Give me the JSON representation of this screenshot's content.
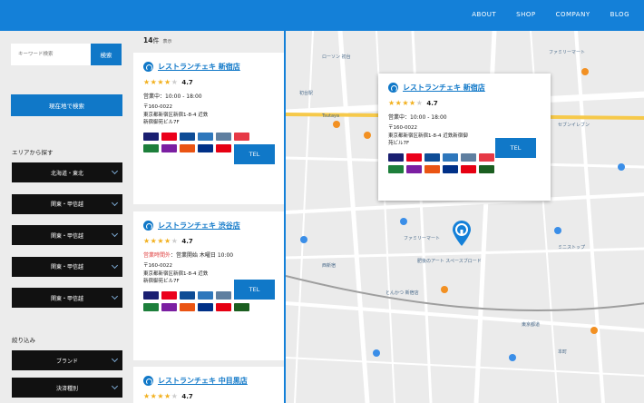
{
  "header": {
    "nav": [
      "ABOUT",
      "SHOP",
      "COMPANY",
      "BLOG"
    ],
    "brand_color": "#1480d8"
  },
  "sidebar": {
    "search_placeholder": "キーワード検索",
    "search_button": "検索",
    "locate_button": "現在地で検索",
    "area_heading": "エリアから探す",
    "areas": [
      "北海道・東北",
      "関東・甲信越",
      "関東・甲信越",
      "関東・甲信越",
      "関東・甲信越"
    ],
    "filter_heading": "絞り込み",
    "filters": [
      "ブランド",
      "決済種別"
    ]
  },
  "results": {
    "count": "14",
    "count_unit": "件",
    "count_suffix": "表示",
    "tel_label": "TEL",
    "cards": [
      {
        "name": "レストランチェキ 新宿店",
        "rating": "4.7",
        "rating_value": 4.7,
        "status": "営業中",
        "hours": "：10:00 - 18:00",
        "zip": "〒160-0022",
        "addr1": "東京都新宿区新宿1-8-4 近鉄",
        "addr2": "新宿御苑ビル7F"
      },
      {
        "name": "レストランチェキ 渋谷店",
        "rating": "4.7",
        "rating_value": 4.7,
        "status": "営業時間外",
        "hours": "：営業開始 木曜日 10:00",
        "zip": "〒160-0022",
        "addr1": "東京都新宿区新宿1-8-4 近鉄",
        "addr2": "新宿御苑ビル7F"
      },
      {
        "name": "レストランチェキ 中目黒店",
        "rating": "4.7",
        "rating_value": 4.7
      }
    ]
  },
  "map": {
    "popup": {
      "name": "レストランチェキ 新宿店",
      "rating": "4.7",
      "rating_value": 4.7,
      "status": "営業中",
      "hours": "：10:00 - 18:00",
      "zip": "〒160-0022",
      "addr1": "東京都新宿区新宿1-8-4 近鉄新宿御",
      "addr2": "苑ビル7F"
    },
    "labels": [
      "ローソン 初台",
      "初台駅",
      "ファミリーマート",
      "Tsutaya",
      "セブンイレブン",
      "ファミリーマート",
      "肥後のアート スペースブロード",
      "とんかつ 新宿店",
      "ミニストップ",
      "東京都道",
      "西新宿",
      "本町"
    ]
  },
  "payment_colors": [
    "#1a1f71",
    "#eb001b",
    "#0e4c96",
    "#2e77bc",
    "#5f7fa0",
    "#e63946",
    "#1d7f3b",
    "#7b1fa2",
    "#ea5413",
    "#003087",
    "#e60012",
    "#1b5e20"
  ]
}
